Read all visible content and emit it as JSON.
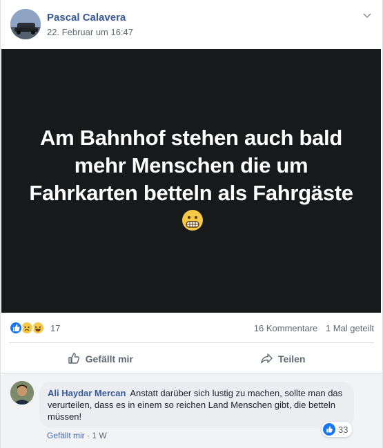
{
  "post": {
    "author": "Pascal Calavera",
    "timestamp": "22. Februar um 16:47",
    "image_text": "Am Bahnhof stehen auch bald mehr Menschen die um Fahrkarten betteln als Fahrgäste",
    "image_emoji": "grimacing-face"
  },
  "stats": {
    "reactions": [
      "like",
      "sad",
      "haha"
    ],
    "reaction_count": "17",
    "comments": "16 Kommentare",
    "shares": "1 Mal geteilt"
  },
  "actions": {
    "like_label": "Gefällt mir",
    "share_label": "Teilen"
  },
  "comment": {
    "author": "Ali Haydar Mercan",
    "text": "Anstatt darüber sich lustig zu machen, sollte man das verurteilen, dass es in einem so reichen Land Menschen gibt, die betteln müssen!",
    "like_label": "Gefällt mir",
    "separator": "·",
    "age": "1 W",
    "reaction_count": "33"
  },
  "colors": {
    "link": "#365899",
    "like_blue": "#1877f2",
    "post_background": "#18191a",
    "meta_gray": "#606770"
  }
}
